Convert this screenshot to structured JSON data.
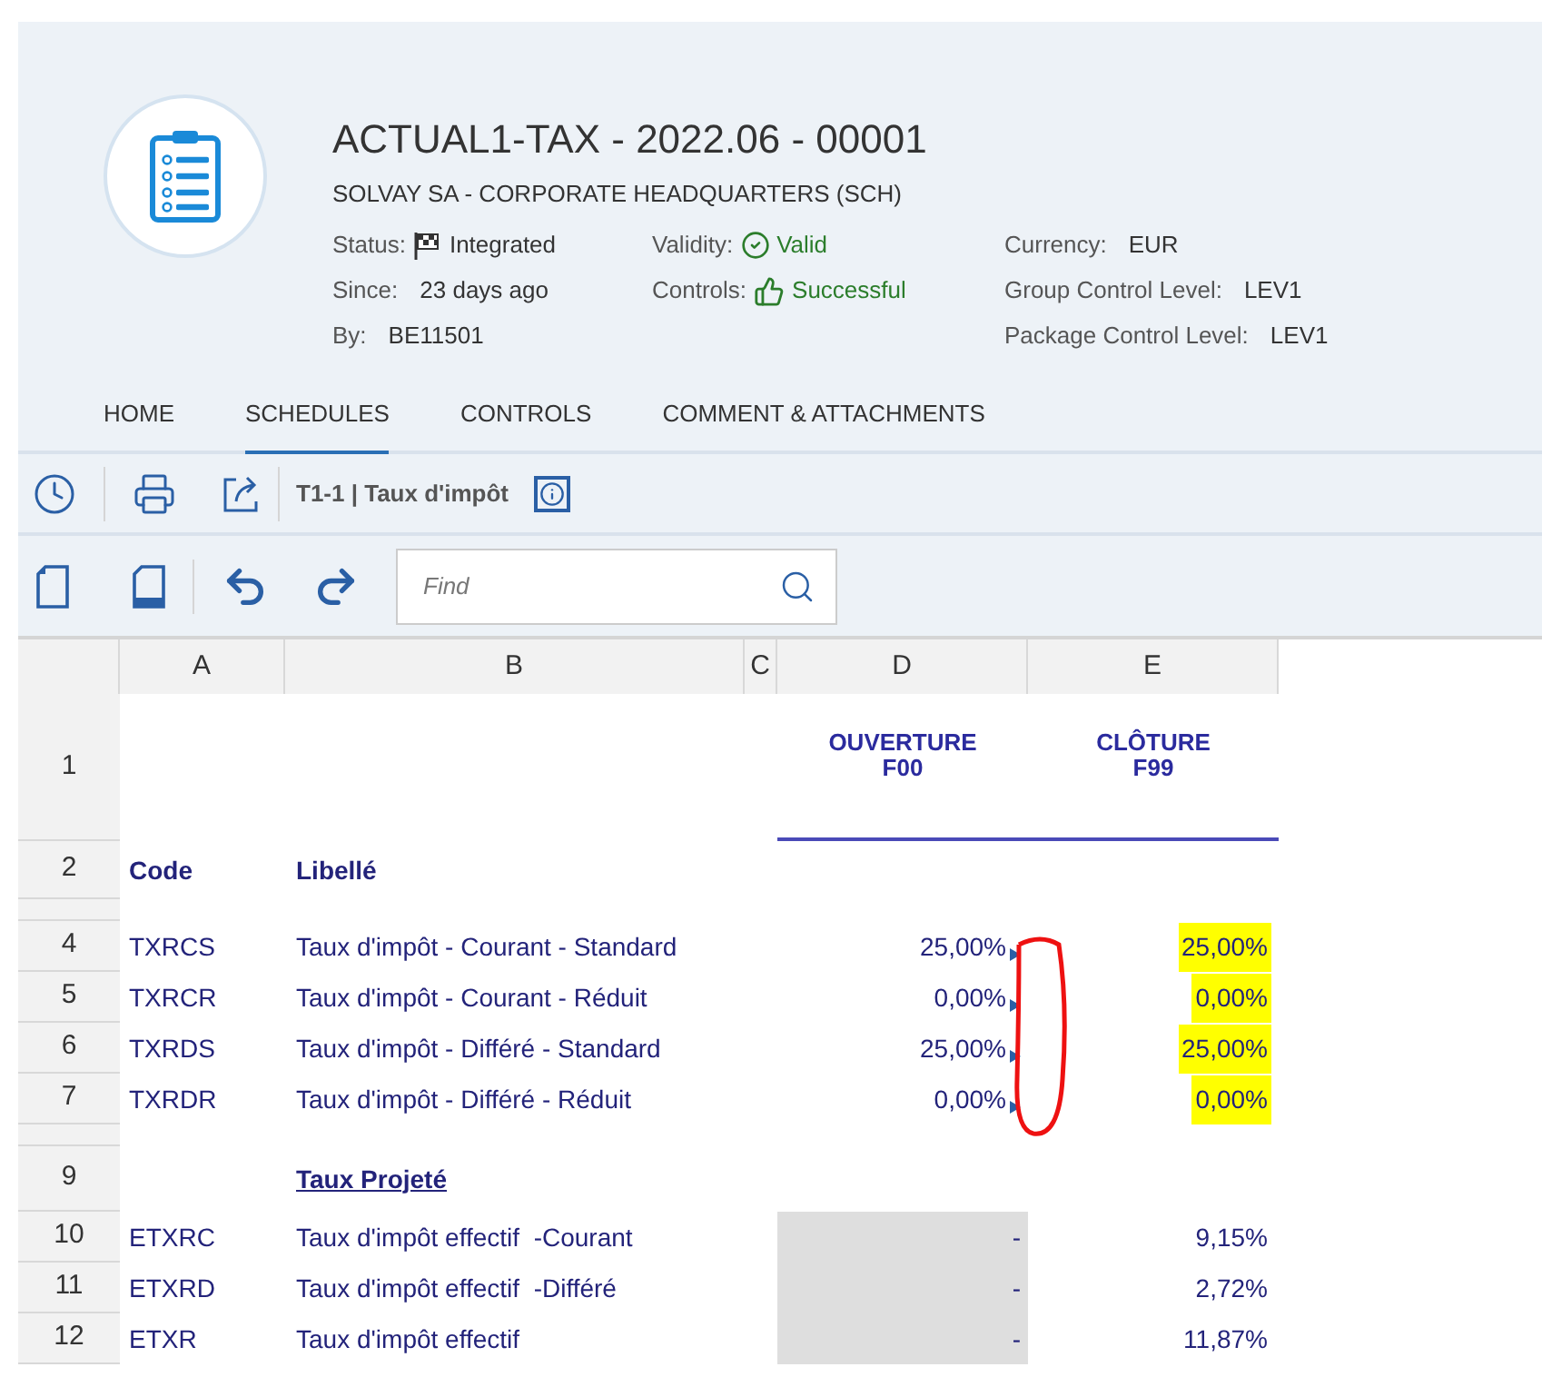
{
  "header": {
    "title": "ACTUAL1-TAX - 2022.06 - 00001",
    "subtitle": "SOLVAY SA - CORPORATE HEADQUARTERS (SCH)",
    "fields": [
      {
        "label": "Status:",
        "value": "Integrated",
        "kind": "flag"
      },
      {
        "label": "Validity:",
        "value": "Valid",
        "kind": "check"
      },
      {
        "label": "Currency:",
        "value": "EUR",
        "kind": "plain"
      },
      {
        "label": "Since:",
        "value": "23 days ago",
        "kind": "plain"
      },
      {
        "label": "Controls:",
        "value": "Successful",
        "kind": "thumb"
      },
      {
        "label": "Group Control Level:",
        "value": "LEV1",
        "kind": "plain"
      },
      {
        "label": "By:",
        "value": "BE11501",
        "kind": "plain"
      },
      {
        "kind": "empty"
      },
      {
        "label": "Package Control Level:",
        "value": "LEV1",
        "kind": "plain"
      }
    ]
  },
  "tabs": [
    {
      "label": "HOME",
      "selected": false
    },
    {
      "label": "SCHEDULES",
      "selected": true
    },
    {
      "label": "CONTROLS",
      "selected": false
    },
    {
      "label": "COMMENT & ATTACHMENTS",
      "selected": false
    }
  ],
  "toolbar": {
    "schedule_title": "T1-1 | Taux d'impôt"
  },
  "find": {
    "placeholder": "Find"
  },
  "sheet": {
    "columns": [
      "A",
      "B",
      "C",
      "D",
      "E"
    ],
    "rows": [
      {
        "kind": "heading",
        "number": "1",
        "d": [
          "OUVERTURE",
          "F00"
        ],
        "e": [
          "CLÔTURE",
          "F99"
        ]
      },
      {
        "kind": "labels",
        "number": "2",
        "code": "Code",
        "label": "Libellé"
      },
      {
        "kind": "spacer"
      },
      {
        "kind": "data",
        "number": "4",
        "code": "TXRCS",
        "label": "Taux d'impôt - Courant - Standard",
        "d": "25,00%",
        "e": "25,00%",
        "marker": true,
        "highlighted": true,
        "d_locked": false
      },
      {
        "kind": "data",
        "number": "5",
        "code": "TXRCR",
        "label": "Taux d'impôt - Courant - Réduit",
        "d": "0,00%",
        "e": "0,00%",
        "marker": true,
        "highlighted": true,
        "d_locked": false
      },
      {
        "kind": "data",
        "number": "6",
        "code": "TXRDS",
        "label": "Taux d'impôt - Différé - Standard",
        "d": "25,00%",
        "e": "25,00%",
        "marker": true,
        "highlighted": true,
        "d_locked": false
      },
      {
        "kind": "data",
        "number": "7",
        "code": "TXRDR",
        "label": "Taux d'impôt - Différé - Réduit",
        "d": "0,00%",
        "e": "0,00%",
        "marker": true,
        "highlighted": true,
        "d_locked": false
      },
      {
        "kind": "spacer"
      },
      {
        "kind": "section",
        "number": "9",
        "label": "Taux Projeté"
      },
      {
        "kind": "data",
        "number": "10",
        "code": "ETXRC",
        "label": "Taux d'impôt effectif  -Courant",
        "d": "-",
        "e": "9,15%",
        "marker": false,
        "highlighted": false,
        "d_locked": true
      },
      {
        "kind": "data",
        "number": "11",
        "code": "ETXRD",
        "label": "Taux d'impôt effectif  -Différé",
        "d": "-",
        "e": "2,72%",
        "marker": false,
        "highlighted": false,
        "d_locked": true
      },
      {
        "kind": "data",
        "number": "12",
        "code": "ETXR",
        "label": "Taux d'impôt effectif",
        "d": "-",
        "e": "11,87%",
        "marker": false,
        "highlighted": false,
        "d_locked": true
      }
    ]
  }
}
